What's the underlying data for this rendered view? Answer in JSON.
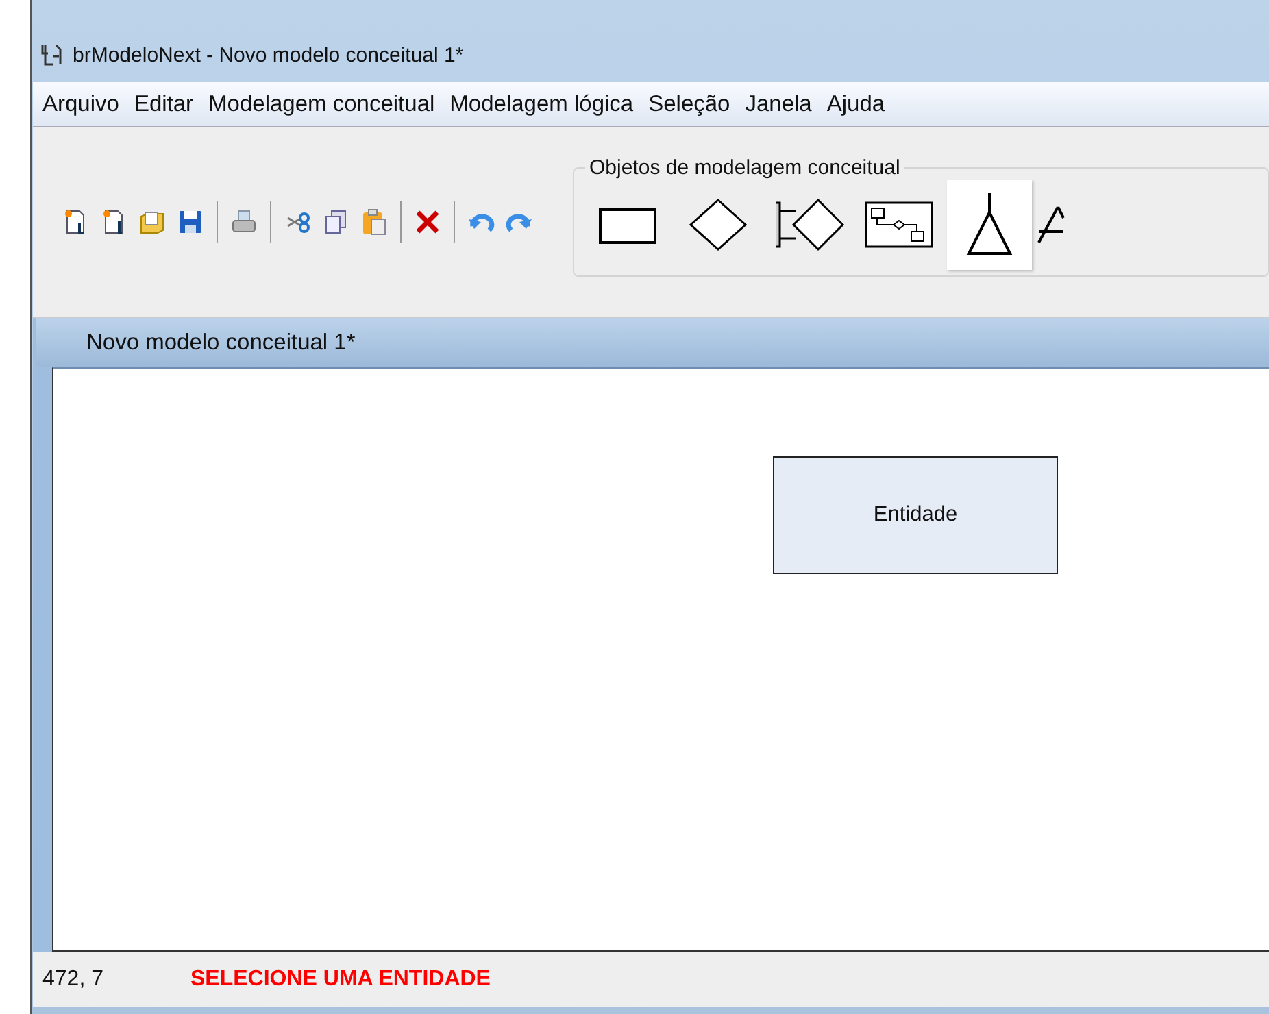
{
  "window": {
    "title": "brModeloNext - Novo modelo conceitual 1*"
  },
  "menu": [
    "Arquivo",
    "Editar",
    "Modelagem conceitual",
    "Modelagem lógica",
    "Seleção",
    "Janela",
    "Ajuda"
  ],
  "toolbar": [
    {
      "kind": "new"
    },
    {
      "kind": "new-logic"
    },
    {
      "kind": "open"
    },
    {
      "kind": "save"
    },
    {
      "kind": "sep"
    },
    {
      "kind": "print"
    },
    {
      "kind": "sep"
    },
    {
      "kind": "cut"
    },
    {
      "kind": "copy"
    },
    {
      "kind": "paste"
    },
    {
      "kind": "sep"
    },
    {
      "kind": "delete"
    },
    {
      "kind": "sep"
    },
    {
      "kind": "undo"
    },
    {
      "kind": "redo"
    }
  ],
  "palette": {
    "title": "Objetos de modelagem conceitual",
    "tools": [
      {
        "kind": "entity",
        "selected": false
      },
      {
        "kind": "relationship",
        "selected": false
      },
      {
        "kind": "associative",
        "selected": false
      },
      {
        "kind": "self-relationship",
        "selected": false
      },
      {
        "kind": "specialization",
        "selected": true
      },
      {
        "kind": "partial",
        "selected": false
      }
    ]
  },
  "document": {
    "tab": "Novo modelo conceitual 1*",
    "entities": [
      {
        "name": "Entidade"
      }
    ]
  },
  "status_bar": {
    "coordinates": "472, 7",
    "message": "SELECIONE UMA ENTIDADE"
  }
}
